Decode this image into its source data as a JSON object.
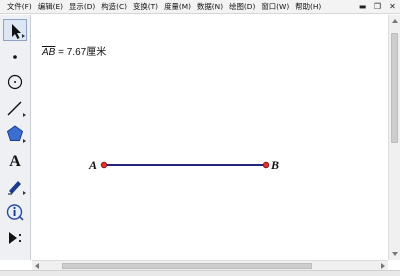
{
  "menubar": {
    "items": [
      {
        "label": "文件(F)"
      },
      {
        "label": "编辑(E)"
      },
      {
        "label": "显示(D)"
      },
      {
        "label": "构造(C)"
      },
      {
        "label": "变换(T)"
      },
      {
        "label": "度量(M)"
      },
      {
        "label": "数据(N)"
      },
      {
        "label": "绘图(D)"
      },
      {
        "label": "窗口(W)"
      },
      {
        "label": "帮助(H)"
      }
    ],
    "window_controls": [
      "▬",
      "❐",
      "✕"
    ]
  },
  "toolbox": {
    "tools": [
      {
        "name": "arrow-select-tool",
        "icon": "arrow-icon",
        "active": true
      },
      {
        "name": "point-tool",
        "icon": "point-icon"
      },
      {
        "name": "compass-tool",
        "icon": "circle-icon"
      },
      {
        "name": "straightedge-tool",
        "icon": "line-icon"
      },
      {
        "name": "polygon-tool",
        "icon": "pentagon-icon"
      },
      {
        "name": "text-tool",
        "icon": "text-a-icon",
        "glyph": "A"
      },
      {
        "name": "marker-tool",
        "icon": "pen-icon"
      },
      {
        "name": "information-tool",
        "icon": "info-icon"
      },
      {
        "name": "custom-tool",
        "icon": "play-more-icon"
      }
    ]
  },
  "canvas": {
    "measurement": {
      "segment": "AB",
      "equals": " = 7.67",
      "unit": "厘米"
    },
    "point_a": {
      "label": "A"
    },
    "point_b": {
      "label": "B"
    },
    "colors": {
      "segment": "#23237a",
      "point_fill": "#e3302c",
      "point_stroke": "#7a1010"
    }
  }
}
